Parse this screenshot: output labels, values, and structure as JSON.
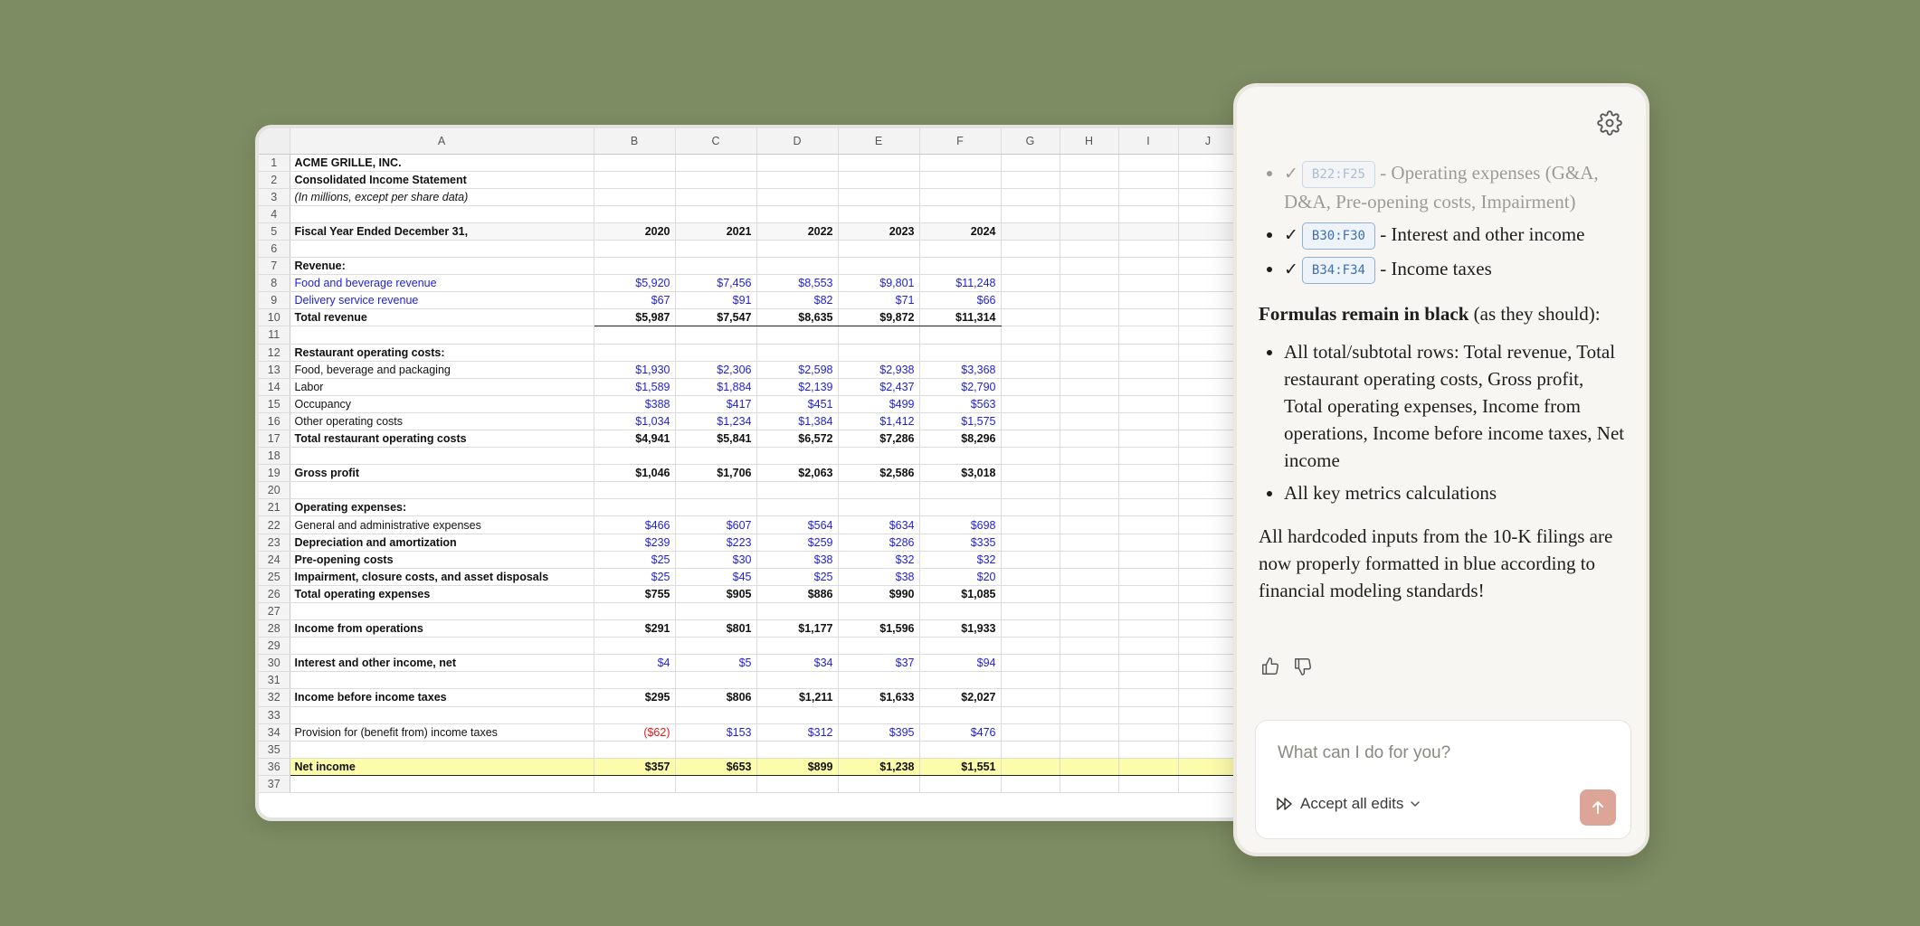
{
  "sheet": {
    "columns": [
      "A",
      "B",
      "C",
      "D",
      "E",
      "F",
      "G",
      "H",
      "I",
      "J"
    ],
    "rows": [
      {
        "n": "1",
        "a": "ACME GRILLE, INC.",
        "bold": true
      },
      {
        "n": "2",
        "a": "Consolidated Income Statement",
        "bold": true
      },
      {
        "n": "3",
        "a": "(In millions, except per share data)",
        "italic": true
      },
      {
        "n": "4"
      },
      {
        "n": "5",
        "a": "Fiscal Year Ended December 31,",
        "bold": true,
        "vals": [
          "2020",
          "2021",
          "2022",
          "2023",
          "2024"
        ],
        "vbold": true,
        "fy": true
      },
      {
        "n": "6"
      },
      {
        "n": "7",
        "a": "Revenue:",
        "bold": true
      },
      {
        "n": "8",
        "a": "Food and beverage revenue",
        "blue": true,
        "vals": [
          "$5,920",
          "$7,456",
          "$8,553",
          "$9,801",
          "$11,248"
        ],
        "vblue": true
      },
      {
        "n": "9",
        "a": "Delivery service revenue",
        "blue": true,
        "vals": [
          "$67",
          "$91",
          "$82",
          "$71",
          "$66"
        ],
        "vblue": true
      },
      {
        "n": "10",
        "a": "Total revenue",
        "bold": true,
        "vals": [
          "$5,987",
          "$7,547",
          "$8,635",
          "$9,872",
          "$11,314"
        ],
        "vbold": true,
        "rev": true
      },
      {
        "n": "11"
      },
      {
        "n": "12",
        "a": "Restaurant operating costs:",
        "bold": true
      },
      {
        "n": "13",
        "a": "Food, beverage and packaging",
        "vals": [
          "$1,930",
          "$2,306",
          "$2,598",
          "$2,938",
          "$3,368"
        ],
        "vblue": true
      },
      {
        "n": "14",
        "a": "Labor",
        "vals": [
          "$1,589",
          "$1,884",
          "$2,139",
          "$2,437",
          "$2,790"
        ],
        "vblue": true
      },
      {
        "n": "15",
        "a": "Occupancy",
        "vals": [
          "$388",
          "$417",
          "$451",
          "$499",
          "$563"
        ],
        "vblue": true
      },
      {
        "n": "16",
        "a": "Other operating costs",
        "vals": [
          "$1,034",
          "$1,234",
          "$1,384",
          "$1,412",
          "$1,575"
        ],
        "vblue": true
      },
      {
        "n": "17",
        "a": "Total restaurant operating costs",
        "bold": true,
        "vals": [
          "$4,941",
          "$5,841",
          "$6,572",
          "$7,286",
          "$8,296"
        ],
        "vbold": true
      },
      {
        "n": "18"
      },
      {
        "n": "19",
        "a": "Gross profit",
        "bold": true,
        "vals": [
          "$1,046",
          "$1,706",
          "$2,063",
          "$2,586",
          "$3,018"
        ],
        "vbold": true
      },
      {
        "n": "20"
      },
      {
        "n": "21",
        "a": "Operating expenses:",
        "bold": true
      },
      {
        "n": "22",
        "a": "General and administrative expenses",
        "vals": [
          "$466",
          "$607",
          "$564",
          "$634",
          "$698"
        ],
        "vblue": true
      },
      {
        "n": "23",
        "a": "Depreciation and amortization",
        "bold": true,
        "vals": [
          "$239",
          "$223",
          "$259",
          "$286",
          "$335"
        ],
        "vblue": true
      },
      {
        "n": "24",
        "a": "Pre-opening costs",
        "bold": true,
        "vals": [
          "$25",
          "$30",
          "$38",
          "$32",
          "$32"
        ],
        "vblue": true
      },
      {
        "n": "25",
        "a": "Impairment, closure costs, and asset disposals",
        "bold": true,
        "vals": [
          "$25",
          "$45",
          "$25",
          "$38",
          "$20"
        ],
        "vblue": true
      },
      {
        "n": "26",
        "a": "Total operating expenses",
        "bold": true,
        "vals": [
          "$755",
          "$905",
          "$886",
          "$990",
          "$1,085"
        ],
        "vbold": true
      },
      {
        "n": "27"
      },
      {
        "n": "28",
        "a": "Income from operations",
        "bold": true,
        "vals": [
          "$291",
          "$801",
          "$1,177",
          "$1,596",
          "$1,933"
        ],
        "vbold": true
      },
      {
        "n": "29"
      },
      {
        "n": "30",
        "a": "Interest and other income, net",
        "bold": true,
        "vals": [
          "$4",
          "$5",
          "$34",
          "$37",
          "$94"
        ],
        "vblue": true
      },
      {
        "n": "31"
      },
      {
        "n": "32",
        "a": "Income before income taxes",
        "bold": true,
        "vals": [
          "$295",
          "$806",
          "$1,211",
          "$1,633",
          "$2,027"
        ],
        "vbold": true
      },
      {
        "n": "33"
      },
      {
        "n": "34",
        "a": "Provision for (benefit from) income taxes",
        "vals": [
          "($62)",
          "$153",
          "$312",
          "$395",
          "$476"
        ],
        "vblue": true,
        "redFirst": true
      },
      {
        "n": "35"
      },
      {
        "n": "36",
        "a": "Net income",
        "bold": true,
        "vals": [
          "$357",
          "$653",
          "$899",
          "$1,238",
          "$1,551"
        ],
        "vbold": true,
        "hl": true
      },
      {
        "n": "37"
      }
    ]
  },
  "panel": {
    "items": [
      {
        "range": "B22:F25",
        "text": " - Operating expenses (G&A, D&A, Pre-opening costs, Impairment)",
        "faded": true
      },
      {
        "range": "B30:F30",
        "text": " - Interest and other income"
      },
      {
        "range": "B34:F34",
        "text": " - Income taxes"
      }
    ],
    "check": "✓",
    "formulas_heading": "Formulas remain in black",
    "formulas_suffix": " (as they should):",
    "formula_items": [
      "All total/subtotal rows: Total revenue, Total restaurant operating costs, Gross profit, Total operating expenses, Income from operations, Income before income taxes, Net income",
      "All key metrics calculations"
    ],
    "closing": "All hardcoded inputs from the 10-K filings are now properly formatted in blue according to financial modeling standards!",
    "input_placeholder": "What can I do for you?",
    "accept_label": "Accept all edits"
  },
  "colors": {
    "input_blue": "#1f1fd6",
    "negative_red": "#e01818",
    "net_income_highlight": "#fdfcab",
    "send_button": "#dca597"
  }
}
